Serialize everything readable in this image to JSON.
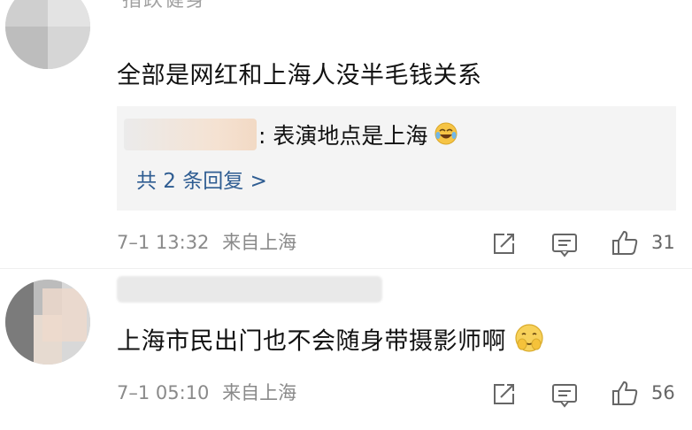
{
  "comments": [
    {
      "truncated_name": "指跌健身",
      "text": "全部是网红和上海人没半毛钱关系",
      "reply": {
        "sep": ":",
        "text": "表演地点是上海",
        "emoji": "laugh-cry-emoji",
        "more": "共 2 条回复 >"
      },
      "time": "7–1 13:32",
      "source": "来自上海",
      "likes": "31"
    },
    {
      "text": "上海市民出门也不会随身带摄影师啊",
      "emoji": "clap-emoji",
      "time": "7–1 05:10",
      "source": "来自上海",
      "likes": "56"
    }
  ],
  "icons": {
    "repost": "repost-icon",
    "comment": "comment-icon",
    "like": "like-icon"
  },
  "colors": {
    "link": "#2f5d92",
    "meta": "#8a8a8a",
    "reply_bg": "#f4f4f4"
  }
}
